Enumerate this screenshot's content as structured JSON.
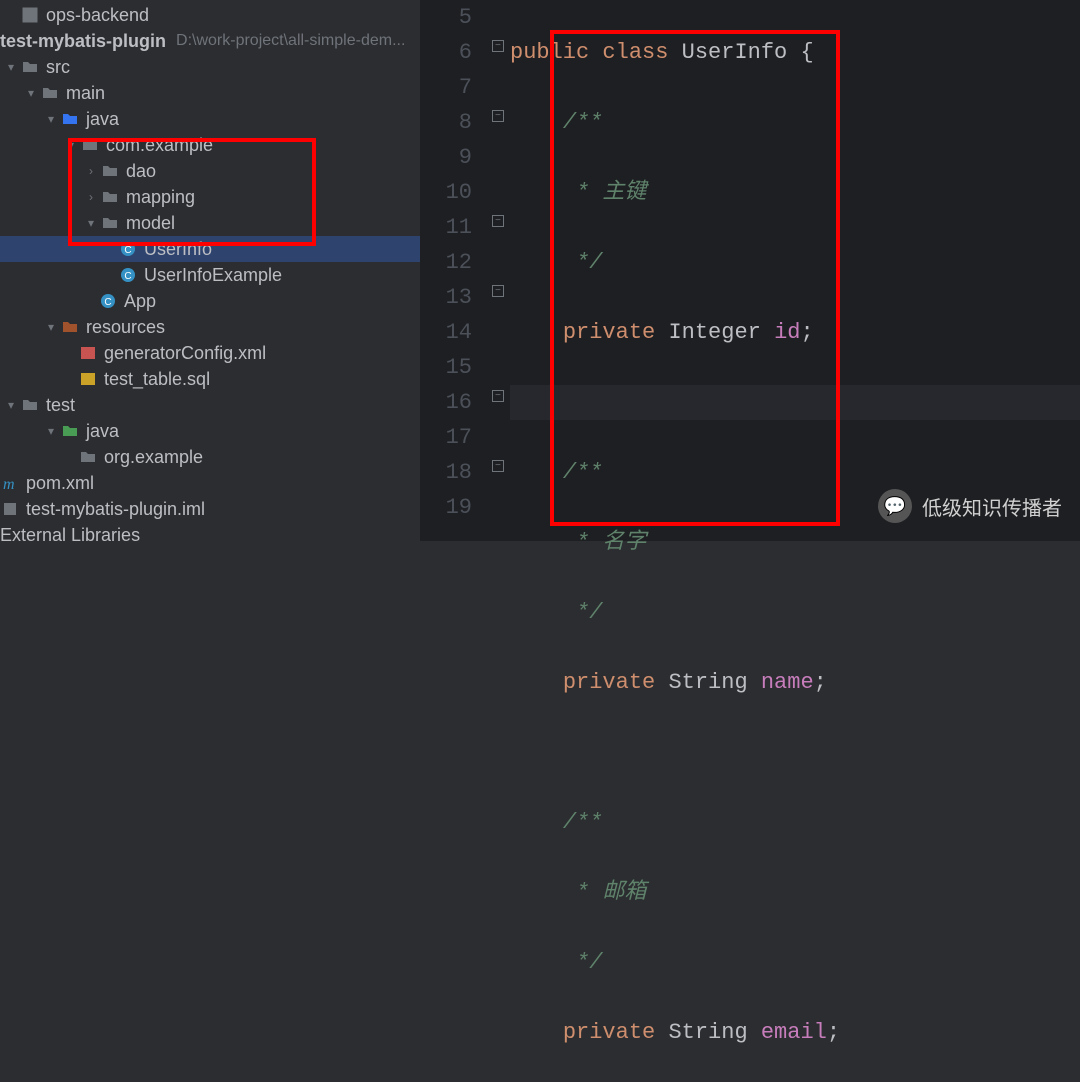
{
  "project": {
    "topItem": "ops-backend",
    "name": "test-mybatis-plugin",
    "path": "D:\\work-project\\all-simple-dem...",
    "iml": "test-mybatis-plugin.iml",
    "pom": "pom.xml",
    "externalLibs": "External Libraries"
  },
  "tree": {
    "src": "src",
    "main": "main",
    "java": "java",
    "pkg": "com.example",
    "dao": "dao",
    "mapping": "mapping",
    "model": "model",
    "userInfo": "UserInfo",
    "userInfoExample": "UserInfoExample",
    "app": "App",
    "resources": "resources",
    "genConfig": "generatorConfig.xml",
    "testTable": "test_table.sql",
    "test": "test",
    "testJava": "java",
    "orgExample": "org.example"
  },
  "code": {
    "decl_public": "public",
    "decl_class": "class",
    "decl_name": "UserInfo",
    "decl_open": "{",
    "c_open": "/**",
    "c_pk": " * 主键",
    "c_close": " */",
    "priv": "private",
    "t_int": "Integer",
    "f_id": "id",
    "semi": ";",
    "c_name": " * 名字",
    "t_str": "String",
    "f_name": "name",
    "c_email": " * 邮箱",
    "f_email": "email"
  },
  "lineNumbers": [
    "5",
    "6",
    "7",
    "8",
    "9",
    "10",
    "11",
    "12",
    "13",
    "14",
    "15",
    "16",
    "17",
    "18",
    "19"
  ],
  "watermark": "低级知识传播者"
}
